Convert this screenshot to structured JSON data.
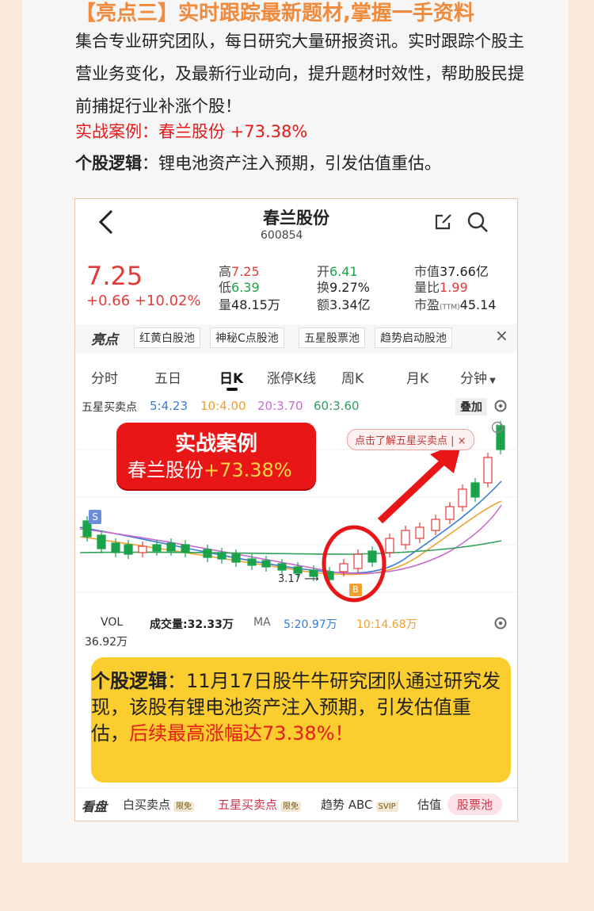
{
  "article": {
    "heading": "【亮点三】实时跟踪最新题材,掌握一手资料",
    "paragraph": "集合专业研究团队，每日研究大量研报资讯。实时跟踪个股主营业务变化，及最新行业动向，提升题材时效性，帮助股民提前捕捉行业补涨个股！",
    "case_line": "实战案例：春兰股份 +73.38%",
    "logic_label": "个股逻辑",
    "logic_text": "：锂电池资产注入预期，引发估值重估。"
  },
  "app": {
    "back_icon": "chevron-left-icon",
    "stock_name": "春兰股份",
    "stock_code": "600854",
    "header_icons": [
      "edit-icon",
      "search-icon"
    ],
    "price": "7.25",
    "change": "+0.66 +10.02%",
    "quotes": {
      "high_label": "高",
      "high": "7.25",
      "low_label": "低",
      "low": "6.39",
      "vol_label": "量",
      "vol": "48.15万",
      "open_label": "开",
      "open": "6.41",
      "turnover_label": "换",
      "turnover": "9.27%",
      "amount_label": "额",
      "amount": "3.34亿",
      "mcap_label": "市值",
      "mcap": "37.66亿",
      "vratio_label": "量比",
      "vratio": "1.99",
      "pe_label": "市盈",
      "pe_sub": "(TTM)",
      "pe": "45.14"
    },
    "tags_title": "亮点",
    "tags": [
      "红黄白股池",
      "神秘C点股池",
      "五星股票池",
      "趋势启动股池"
    ],
    "close_icon": "×",
    "tabs": [
      "分时",
      "五日",
      "日K",
      "涨停K线",
      "周K",
      "月K",
      "分钟"
    ],
    "indicator": {
      "label": "五星买卖点",
      "ma5": "5:4.23",
      "ma10": "10:4.00",
      "ma20": "20:3.70",
      "ma60": "60:3.60",
      "overlay": "叠加"
    },
    "chart": {
      "low_label": "3.17",
      "s_marker": "S",
      "b_marker": "B"
    },
    "case_box": {
      "title": "实战案例",
      "name": "春兰股份",
      "pct": "+73.38%"
    },
    "understand": "点击了解五星买卖点 | ×",
    "volume": {
      "label": "VOL",
      "total": "成交量:32.33万",
      "ma": "MA",
      "ma5": "5:20.97万",
      "ma10": "10:14.68万",
      "max": "36.92万"
    },
    "logic_box": {
      "label": "个股逻辑",
      "text": "：11月17日股牛牛研究团队通过研究发现，该股有锂电池资产注入预期，引发估值重估，",
      "highlight": "后续最高涨幅达73.38%！"
    },
    "bottom": {
      "title": "看盘",
      "item1": "白买卖点",
      "item1_badge": "限免",
      "item2": "五星买卖点",
      "item2_badge": "限免",
      "item3": "趋势 ABC",
      "item3_badge": "SVIP",
      "item4": "估值",
      "stockpool": "股票池"
    },
    "colors": {
      "up": "#e23b3b",
      "down": "#1aa34a",
      "ma5": "#3a7bd5",
      "ma10": "#f0a030",
      "ma20": "#c86ad0",
      "ma60": "#2fa05a"
    }
  }
}
